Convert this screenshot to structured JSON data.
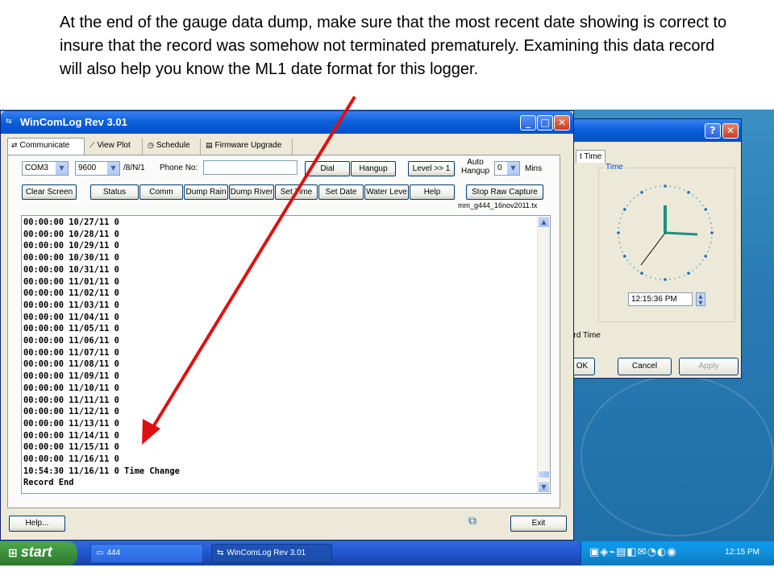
{
  "caption": "At the end of the gauge data dump, make sure that the most recent date showing is correct to insure that the record was somehow not terminated prematurely. Examining this data record will also help you know the ML1 date format for this logger.",
  "window": {
    "title": "WinComLog Rev 3.01",
    "tabs": [
      {
        "label": "Communicate",
        "icon": "connect-icon"
      },
      {
        "label": "View Plot",
        "icon": "chart-icon"
      },
      {
        "label": "Schedule",
        "icon": "clock-icon"
      },
      {
        "label": "Firmware Upgrade",
        "icon": "chip-icon"
      }
    ],
    "controls": {
      "com_port": "COM3",
      "baud": "9600",
      "format": "/8/N/1",
      "phone_label": "Phone No:",
      "dial": "Dial",
      "hangup": "Hangup",
      "level": "Level >> 1",
      "auto_hangup": "Auto\nHangup",
      "auto_hangup_value": "0",
      "mins": "Mins"
    },
    "buttons": {
      "clear_screen": "Clear Screen",
      "status": "Status",
      "comm": "Comm",
      "dump_rain": "Dump Rain",
      "dump_river": "Dump River",
      "set_time": "Set Time",
      "set_date": "Set Date",
      "water_level": "Water Leve",
      "help": "Help",
      "stop_raw_capture": "Stop Raw Capture"
    },
    "capture_file": "mm_g444_16nov2011.tx",
    "log_lines": [
      "00:00:00 10/27/11 0",
      "00:00:00 10/28/11 0",
      "00:00:00 10/29/11 0",
      "00:00:00 10/30/11 0",
      "00:00:00 10/31/11 0",
      "00:00:00 11/01/11 0",
      "00:00:00 11/02/11 0",
      "00:00:00 11/03/11 0",
      "00:00:00 11/04/11 0",
      "00:00:00 11/05/11 0",
      "00:00:00 11/06/11 0",
      "00:00:00 11/07/11 0",
      "00:00:00 11/08/11 0",
      "00:00:00 11/09/11 0",
      "00:00:00 11/10/11 0",
      "00:00:00 11/11/11 0",
      "00:00:00 11/12/11 0",
      "00:00:00 11/13/11 0",
      "00:00:00 11/14/11 0",
      "00:00:00 11/15/11 0",
      "00:00:00 11/16/11 0",
      "10:54:30 11/16/11 0 Time Change",
      "Record End"
    ],
    "help_btn": "Help...",
    "exit_btn": "Exit"
  },
  "bg_dialog": {
    "tab_label": "t Time",
    "clock_group": "Time",
    "time_value": "12:15:36 PM",
    "bottom_text": "ard Time",
    "ok": "OK",
    "cancel": "Cancel",
    "apply": "Apply"
  },
  "taskbar": {
    "start": "start",
    "tasks": [
      "444",
      "WinComLog Rev 3.01"
    ],
    "clock": "12:15 PM"
  },
  "colors": {
    "arrow": "#e01010",
    "title_blue": "#0a5fd8",
    "window_bg": "#ece9d8"
  }
}
